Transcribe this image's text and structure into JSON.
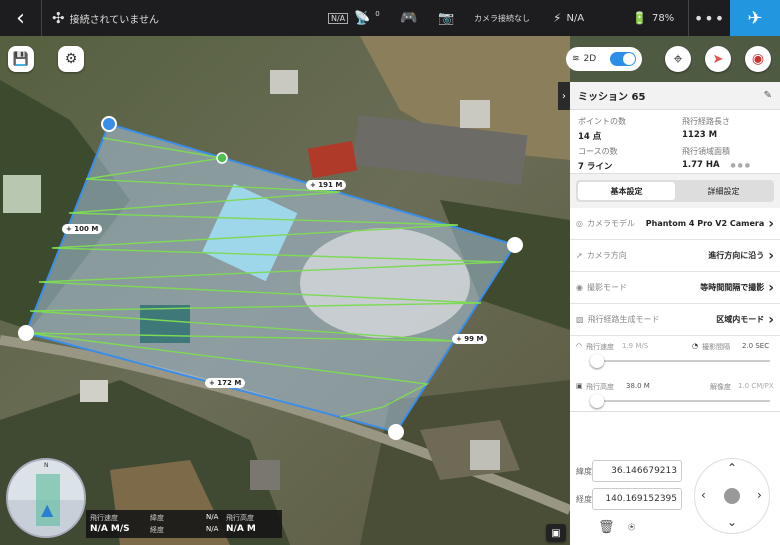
{
  "topbar": {
    "status": "接続されていません",
    "rtk": "N/A",
    "gps_count": "0",
    "camera": "カメラ接続なし",
    "signal": "N/A",
    "battery": "78%",
    "more_icon": "more-icon",
    "send_icon": "paper-plane-icon"
  },
  "map": {
    "view_label": "2D",
    "distances": {
      "top": "+ 191 M",
      "left": "+ 100 M",
      "right": "+ 99 M",
      "bottom": "+ 172 M"
    },
    "telemetry": {
      "speed_label": "飛行速度",
      "speed_value": "N/A M/S",
      "lat_label": "緯度",
      "lat_value": "N/A",
      "lon_label": "経度",
      "lon_value": "N/A",
      "alt_label": "飛行高度",
      "alt_value": "N/A M",
      "compass_n": "N"
    }
  },
  "panel": {
    "mission_title": "ミッション 65",
    "stats": {
      "points_label": "ポイントの数",
      "points_value": "14 点",
      "length_label": "飛行経路長さ",
      "length_value": "1123 M",
      "courses_label": "コースの数",
      "courses_value": "7 ライン",
      "area_label": "飛行領域面積",
      "area_value": "1.77 HA"
    },
    "tabs": {
      "basic": "基本設定",
      "advanced": "詳細設定"
    },
    "settings": [
      {
        "label": "カメラモデル",
        "value": "Phantom 4 Pro V2 Camera"
      },
      {
        "label": "カメラ方向",
        "value": "進行方向に沿う"
      },
      {
        "label": "撮影モード",
        "value": "等時間間隔で撮影"
      },
      {
        "label": "飛行経路生成モード",
        "value": "区域内モード"
      }
    ],
    "speed": {
      "label": "飛行速度",
      "value": "1.9 M/S",
      "interval_label": "撮影間隔",
      "interval_value": "2.0 SEC"
    },
    "altitude": {
      "label": "飛行高度",
      "value": "38.0 M",
      "res_label": "解像度",
      "res_value": "1.0 CM/PX"
    },
    "coords": {
      "lat_label": "緯度",
      "lat_value": "36.146679213",
      "lon_label": "経度",
      "lon_value": "140.169152395"
    }
  }
}
